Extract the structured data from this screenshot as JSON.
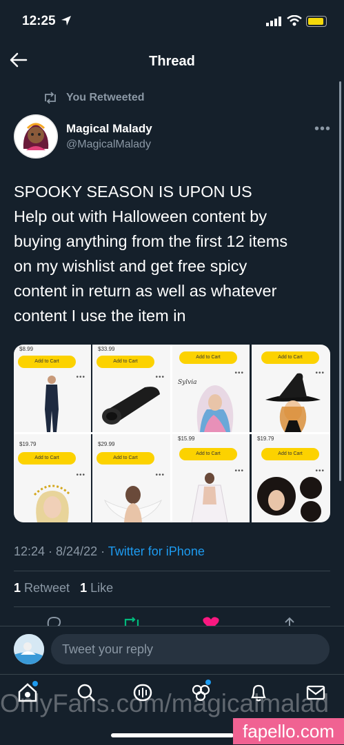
{
  "status_bar": {
    "time": "12:25"
  },
  "nav": {
    "title": "Thread"
  },
  "retweet_context": {
    "label": "You Retweeted"
  },
  "author": {
    "name": "Magical Malady",
    "handle": "@MagicalMalady"
  },
  "tweet": {
    "lines": [
      "SPOOKY SEASON IS UPON US",
      "Help out with Halloween content by",
      "buying anything from the first 12 items",
      "on my wishlist and get free spicy",
      "content in return as well as whatever",
      "content I use the item in"
    ]
  },
  "media": {
    "cells": [
      {
        "price": "$8.99",
        "cart": "Add to Cart"
      },
      {
        "price": "$33.99",
        "cart": "Add to Cart"
      },
      {
        "price": "",
        "cart": "Add to Cart",
        "label": "Sylvia"
      },
      {
        "price": "",
        "cart": "Add to Cart"
      },
      {
        "price": "$19.79",
        "cart": "Add to Cart"
      },
      {
        "price": "$29.99",
        "cart": "Add to Cart"
      },
      {
        "price": "$15.99",
        "cart": "Add to Cart"
      },
      {
        "price": "$19.79",
        "cart": "Add to Cart"
      }
    ]
  },
  "meta": {
    "time": "12:24 · 8/24/22 · ",
    "source": "Twitter for iPhone"
  },
  "stats": {
    "retweets_count": "1",
    "retweets_label": " Retweet",
    "likes_count": "1",
    "likes_label": " Like"
  },
  "reply": {
    "placeholder": "Tweet your reply"
  },
  "watermark": "OnlyFans.com/magicalmalad",
  "site_badge": "fapello.com",
  "colors": {
    "background": "#15202b",
    "accent": "#1d9bf0",
    "like": "#f91880",
    "retweet": "#00ba7c",
    "cart_button": "#fcd200"
  }
}
